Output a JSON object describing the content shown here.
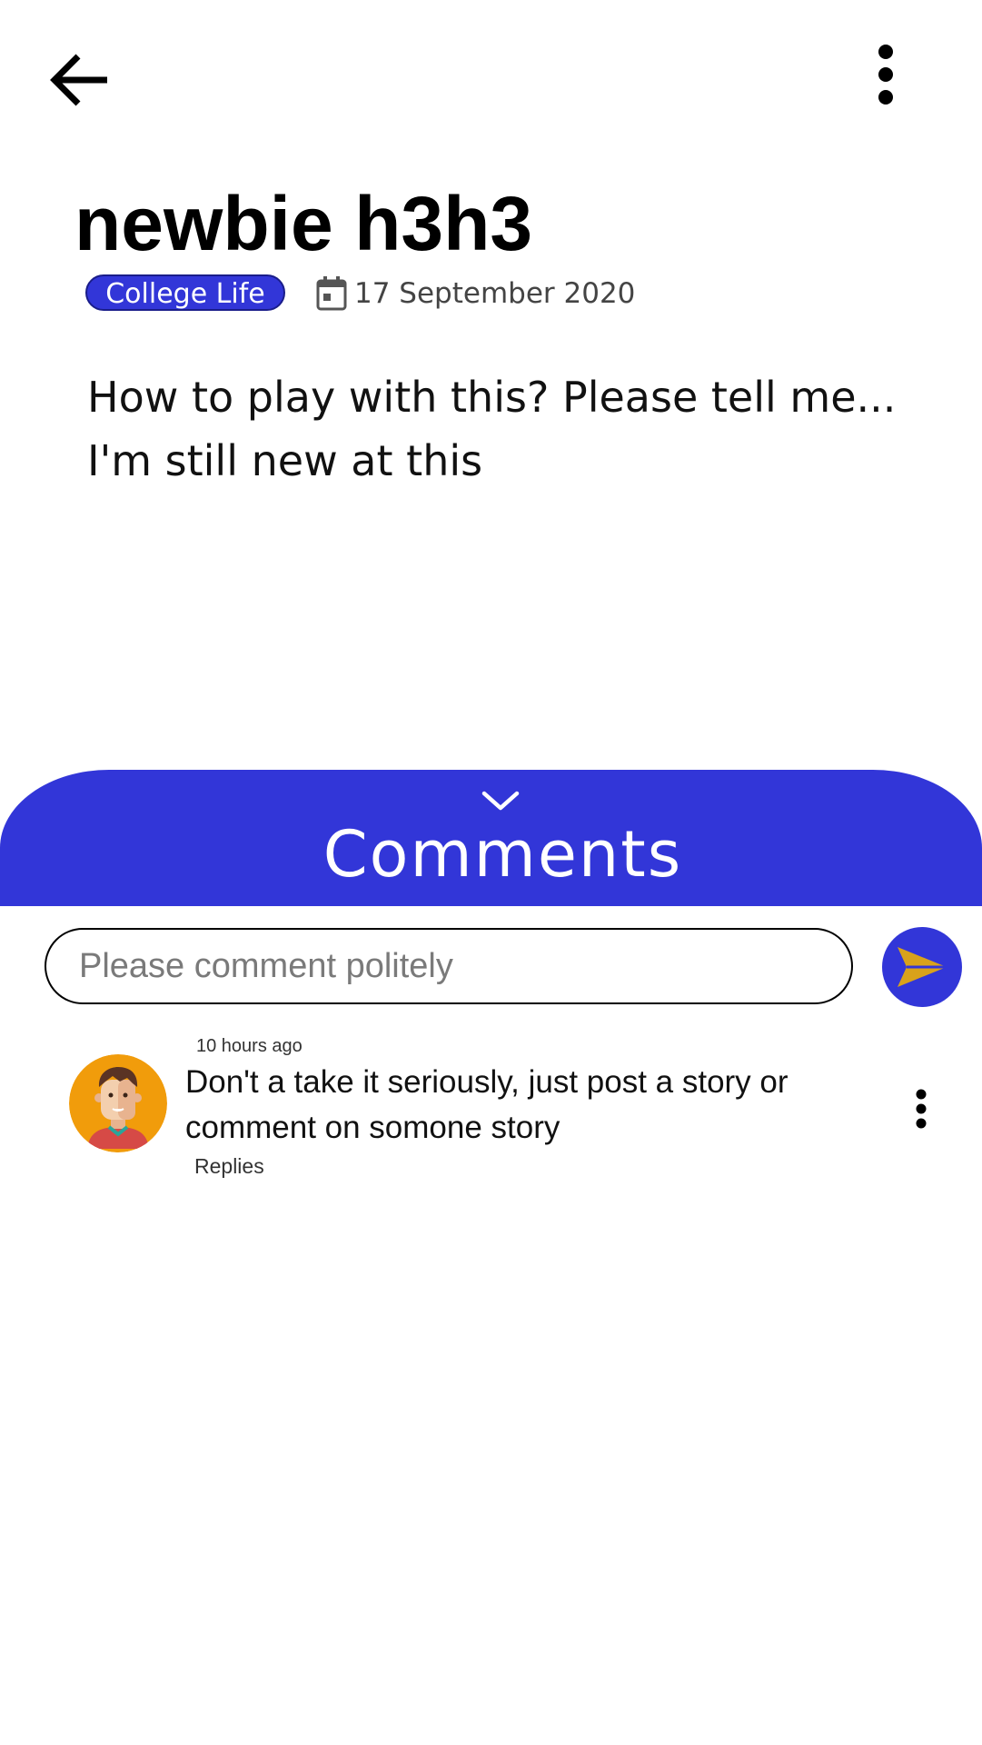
{
  "header": {
    "back_icon": "arrow-left-icon",
    "more_icon": "more-vertical-icon"
  },
  "post": {
    "title": "newbie h3h3",
    "category": "College Life",
    "date": "17 September 2020",
    "body_lines": [
      "How to play with this? Please tell me...",
      "I'm still new at this"
    ]
  },
  "comments": {
    "title": "Comments",
    "collapse_icon": "chevron-down-icon",
    "input_placeholder": "Please comment politely",
    "input_value": "",
    "send_icon": "send-icon",
    "items": [
      {
        "time": "10 hours ago",
        "text": "Don't a take it seriously, just post a story or comment on somone story",
        "replies_label": "Replies",
        "avatar_icon": "user-avatar-icon"
      }
    ]
  },
  "colors": {
    "accent": "#3236d8",
    "send_arrow": "#d9a21b",
    "avatar_bg": "#f19c0b"
  }
}
